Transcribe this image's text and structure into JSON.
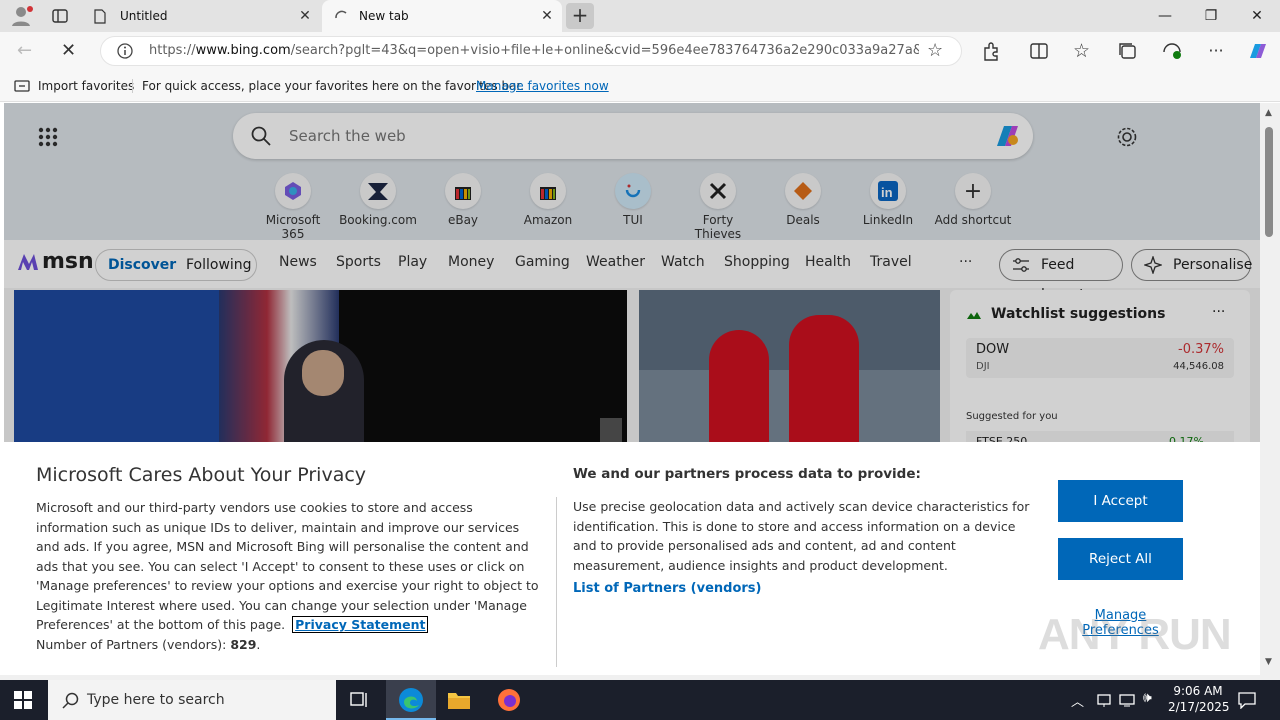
{
  "browser": {
    "tabs": [
      {
        "title": "Untitled"
      },
      {
        "title": "New tab"
      }
    ],
    "address": {
      "scheme": "https://",
      "domain": "www.bing.com",
      "path": "/search?pglt=43&q=open+visio+file+le+online&cvid=596e4ee783764736a2e290c033a9a27a&gs_lc..."
    },
    "favorites_bar": {
      "import_label": "Import favorites",
      "hint": "For quick access, place your favorites here on the favorites bar.",
      "manage_link": "Manage favorites now"
    }
  },
  "newtab": {
    "search_placeholder": "Search the web",
    "shortcuts": [
      {
        "label": "Microsoft 365",
        "icon": "microsoft-365-icon"
      },
      {
        "label": "Booking.com",
        "icon": "booking-icon"
      },
      {
        "label": "eBay",
        "icon": "ebay-icon"
      },
      {
        "label": "Amazon",
        "icon": "amazon-icon"
      },
      {
        "label": "TUI",
        "icon": "tui-icon"
      },
      {
        "label": "Forty Thieves",
        "icon": "forty-thieves-icon"
      },
      {
        "label": "Deals",
        "icon": "deals-icon"
      },
      {
        "label": "LinkedIn",
        "icon": "linkedin-icon"
      },
      {
        "label": "Add shortcut",
        "icon": "plus-icon"
      }
    ]
  },
  "msn": {
    "logo_text": "msn",
    "tabs": [
      "Discover",
      "Following"
    ],
    "nav": [
      "News",
      "Sports",
      "Play",
      "Money",
      "Gaming",
      "Weather",
      "Watch",
      "Shopping",
      "Health",
      "Travel"
    ],
    "more": "···",
    "feed_layout": "Feed layout",
    "personalise": "Personalise"
  },
  "watchlist": {
    "title": "Watchlist suggestions",
    "menu": "···",
    "stock": {
      "name": "DOW",
      "change": "-0.37%",
      "ticker": "DJI",
      "value": "44,546.08"
    },
    "suggested_label": "Suggested for you",
    "next_stock": {
      "name": "FTSE 250",
      "change": "0.17%"
    }
  },
  "consent": {
    "title": "Microsoft Cares About Your Privacy",
    "body": "Microsoft and our third-party vendors use cookies to store and access information such as unique IDs to deliver, maintain and improve our services and ads. If you agree, MSN and Microsoft Bing will personalise the content and ads that you see. You can select 'I Accept' to consent to these uses or click on 'Manage preferences' to review your options and exercise your right to object to Legitimate Interest where used.  You can change your selection under 'Manage Preferences' at the bottom of this page.",
    "privacy_link": "Privacy Statement",
    "partners_label": "Number of Partners (vendors):",
    "partners_count": "829",
    "partners_suffix": ".",
    "col2_title": "We and our partners process data to provide:",
    "col2_body": "Use precise geolocation data and actively scan device characteristics for identification. This is done to store and access information on a device and to provide personalised ads and content, ad and content measurement, audience insights and product development.",
    "vendors_link": "List of Partners (vendors)",
    "accept": "I Accept",
    "reject": "Reject All",
    "manage": "Manage Preferences"
  },
  "taskbar": {
    "search_placeholder": "Type here to search",
    "time": "9:06 AM",
    "date": "2/17/2025"
  },
  "watermark": "ANY RUN",
  "colors": {
    "accent": "#0067b8",
    "negative": "#d13438",
    "positive": "#107c10"
  }
}
